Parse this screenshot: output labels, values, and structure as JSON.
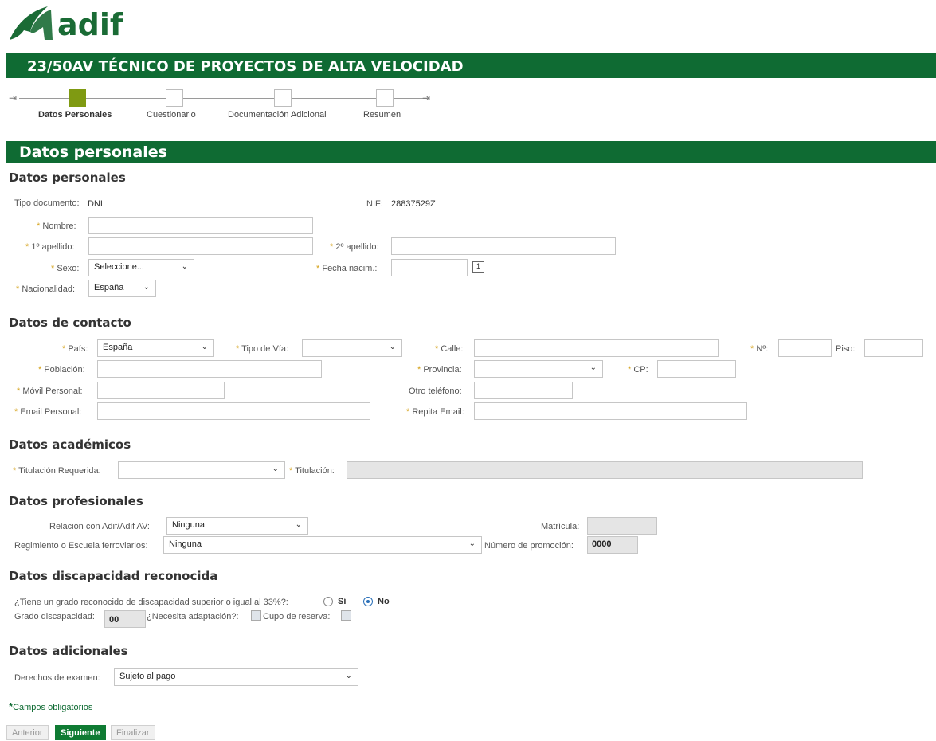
{
  "brand": {
    "name": "adif",
    "color": "#0f6b33",
    "accent": "#7f9a12"
  },
  "page_title": "23/50AV TÉCNICO DE PROYECTOS DE ALTA VELOCIDAD",
  "steps": [
    {
      "label": "Datos Personales",
      "active": true
    },
    {
      "label": "Cuestionario",
      "active": false
    },
    {
      "label": "Documentación Adicional",
      "active": false
    },
    {
      "label": "Resumen",
      "active": false
    }
  ],
  "section_title": "Datos personales",
  "personal": {
    "heading": "Datos personales",
    "tipo_doc_label": "Tipo documento:",
    "tipo_doc_value": "DNI",
    "nif_label": "NIF:",
    "nif_value": "28837529Z",
    "nombre_label": "Nombre:",
    "apellido1_label": "1º apellido:",
    "apellido2_label": "2º apellido:",
    "sexo_label": "Sexo:",
    "sexo_value": "Seleccione...",
    "fecha_label": "Fecha nacim.:",
    "nacionalidad_label": "Nacionalidad:",
    "nacionalidad_value": "España"
  },
  "contacto": {
    "heading": "Datos de contacto",
    "pais_label": "País:",
    "pais_value": "España",
    "tipo_via_label": "Tipo de Vía:",
    "calle_label": "Calle:",
    "numero_label": "Nº:",
    "piso_label": "Piso:",
    "poblacion_label": "Población:",
    "provincia_label": "Provincia:",
    "cp_label": "CP:",
    "movil_label": "Móvil Personal:",
    "otro_tel_label": "Otro teléfono:",
    "email_label": "Email Personal:",
    "repita_email_label": "Repita Email:"
  },
  "academicos": {
    "heading": "Datos académicos",
    "titulacion_req_label": "Titulación Requerida:",
    "titulacion_label": "Titulación:"
  },
  "profesionales": {
    "heading": "Datos profesionales",
    "relacion_label": "Relación con Adif/Adif AV:",
    "relacion_value": "Ninguna",
    "matricula_label": "Matrícula:",
    "regimiento_label": "Regimiento o Escuela ferroviarios:",
    "regimiento_value": "Ninguna",
    "promocion_label": "Número de promoción:",
    "promocion_value": "0000"
  },
  "discapacidad": {
    "heading": "Datos discapacidad reconocida",
    "question": "¿Tiene un grado reconocido de discapacidad superior o igual al 33%?:",
    "opt_si": "Sí",
    "opt_no": "No",
    "selected": "No",
    "grado_label": "Grado discapacidad:",
    "grado_value": "00",
    "adaptacion_label": "¿Necesita adaptación?:",
    "cupo_label": "Cupo de reserva:"
  },
  "adicionales": {
    "heading": "Datos adicionales",
    "derechos_label": "Derechos de examen:",
    "derechos_value": "Sujeto al pago"
  },
  "required_note": "Campos obligatorios",
  "required_marker": "*",
  "buttons": {
    "anterior": "Anterior",
    "siguiente": "Siguiente",
    "finalizar": "Finalizar"
  }
}
